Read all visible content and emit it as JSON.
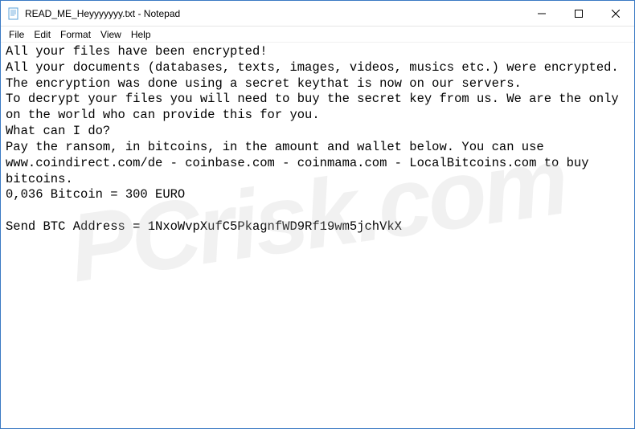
{
  "titlebar": {
    "title": "READ_ME_Heyyyyyyy.txt - Notepad",
    "icon_label": "notepad-icon"
  },
  "menubar": {
    "items": [
      "File",
      "Edit",
      "Format",
      "View",
      "Help"
    ]
  },
  "content": {
    "text": "All your files have been encrypted!\nAll your documents (databases, texts, images, videos, musics etc.) were encrypted.\nThe encryption was done using a secret keythat is now on our servers.\nTo decrypt your files you will need to buy the secret key from us. We are the only on the world who can provide this for you.\nWhat can I do?\nPay the ransom, in bitcoins, in the amount and wallet below. You can use www.coindirect.com/de - coinbase.com - coinmama.com - LocalBitcoins.com to buy bitcoins.\n0,036 Bitcoin = 300 EURO\n\nSend BTC Address = 1NxoWvpXufC5PkagnfWD9Rf19wm5jchVkX"
  },
  "watermark": {
    "text": "PCrisk.com"
  }
}
